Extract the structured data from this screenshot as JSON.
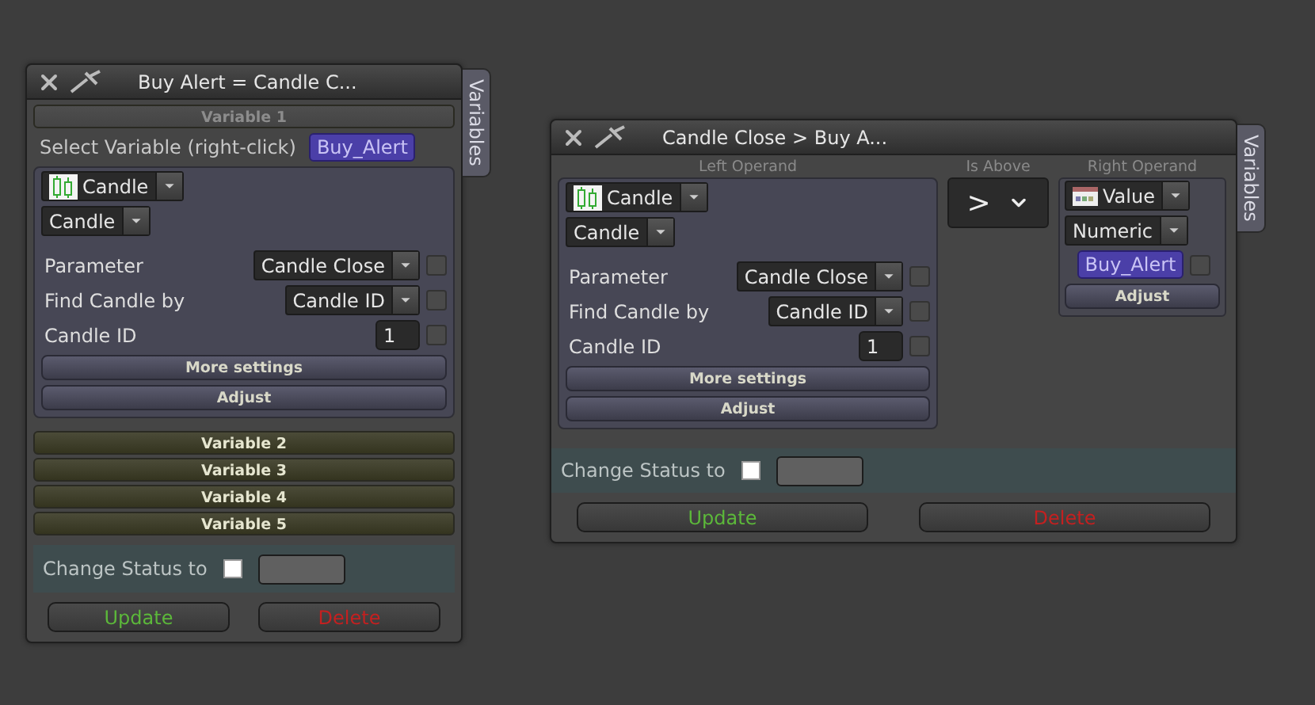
{
  "windows": [
    {
      "kind": "variable",
      "title": "Buy Alert = Candle C...",
      "side_tab": "Variables",
      "variables": [
        {
          "label": "Variable 1",
          "expanded": true,
          "select_label": "Select Variable (right-click)",
          "variable_name": "Buy_Alert",
          "operand": {
            "source": "Candle",
            "type": "Candle",
            "params": [
              {
                "label": "Parameter",
                "kind": "dropdown",
                "value": "Candle Close",
                "checked": false
              },
              {
                "label": "Find Candle by",
                "kind": "dropdown",
                "value": "Candle ID",
                "checked": false
              },
              {
                "label": "Candle ID",
                "kind": "number",
                "value": "1",
                "checked": false
              }
            ],
            "buttons": [
              "More settings",
              "Adjust"
            ]
          }
        },
        {
          "label": "Variable 2",
          "expanded": false
        },
        {
          "label": "Variable 3",
          "expanded": false
        },
        {
          "label": "Variable 4",
          "expanded": false
        },
        {
          "label": "Variable 5",
          "expanded": false
        }
      ],
      "status": {
        "label": "Change Status to",
        "checked": false
      },
      "buttons": [
        {
          "label": "Update",
          "kind": "update"
        },
        {
          "label": "Delete",
          "kind": "delete"
        }
      ]
    },
    {
      "kind": "condition",
      "title": "Candle Close > Buy A...",
      "side_tab": "Variables",
      "left": {
        "heading": "Left Operand",
        "operand": {
          "source": "Candle",
          "type": "Candle",
          "params": [
            {
              "label": "Parameter",
              "kind": "dropdown",
              "value": "Candle Close",
              "checked": false
            },
            {
              "label": "Find Candle by",
              "kind": "dropdown",
              "value": "Candle ID",
              "checked": false
            },
            {
              "label": "Candle ID",
              "kind": "number",
              "value": "1",
              "checked": false
            }
          ],
          "buttons": [
            "More settings",
            "Adjust"
          ]
        }
      },
      "comparator": {
        "heading": "Is Above",
        "value": ">"
      },
      "right": {
        "heading": "Right Operand",
        "source": "Value",
        "type": "Numeric",
        "variable_name": "Buy_Alert",
        "checked": false,
        "button": "Adjust"
      },
      "status": {
        "label": "Change Status to",
        "checked": false
      },
      "buttons": [
        {
          "label": "Update",
          "kind": "update"
        },
        {
          "label": "Delete",
          "kind": "delete"
        }
      ]
    }
  ]
}
